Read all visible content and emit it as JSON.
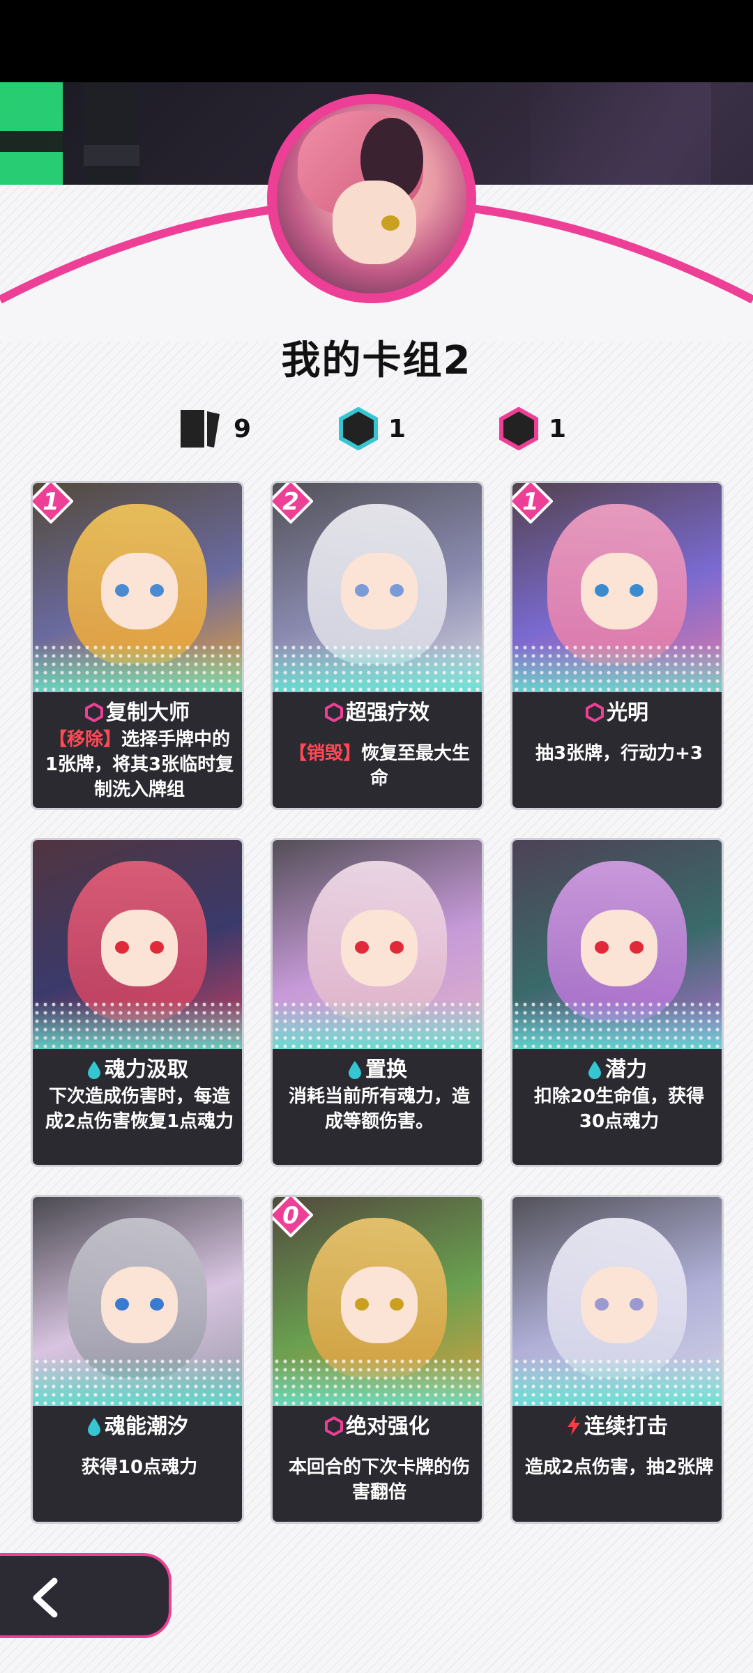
{
  "deck": {
    "title": "我的卡组2",
    "stats": [
      {
        "icon": "card-stack-icon",
        "value": "9"
      },
      {
        "icon": "cyan-hexagon-icon",
        "value": "1"
      },
      {
        "icon": "pink-hexagon-icon",
        "value": "1"
      }
    ]
  },
  "colors": {
    "accent_pink": "#ee3f96",
    "accent_cyan": "#35c6d2",
    "keyword_red": "#ff4a55",
    "card_bg": "#2b2a31"
  },
  "cards": [
    {
      "cost": "1",
      "icon": "hexagon-icon",
      "name": "复制大师",
      "keyword": "【移除】",
      "desc": "选择手牌中的1张牌，将其3张临时复制洗入牌组"
    },
    {
      "cost": "2",
      "icon": "hexagon-icon",
      "name": "超强疗效",
      "keyword": "【销毁】",
      "desc": "恢复至最大生命"
    },
    {
      "cost": "1",
      "icon": "hexagon-icon",
      "name": "光明",
      "keyword": "",
      "desc": "抽3张牌，行动力+3"
    },
    {
      "cost": "",
      "icon": "water-drop-icon",
      "name": "魂力汲取",
      "keyword": "",
      "desc": "下次造成伤害时，每造成2点伤害恢复1点魂力"
    },
    {
      "cost": "",
      "icon": "water-drop-icon",
      "name": "置换",
      "keyword": "",
      "desc": "消耗当前所有魂力，造成等额伤害。"
    },
    {
      "cost": "",
      "icon": "water-drop-icon",
      "name": "潜力",
      "keyword": "",
      "desc": "扣除20生命值，获得30点魂力"
    },
    {
      "cost": "",
      "icon": "water-drop-icon",
      "name": "魂能潮汐",
      "keyword": "",
      "desc": "获得10点魂力"
    },
    {
      "cost": "0",
      "icon": "hexagon-icon",
      "name": "绝对强化",
      "keyword": "",
      "desc": "本回合的下次卡牌的伤害翻倍"
    },
    {
      "cost": "",
      "icon": "lightning-icon",
      "name": "连续打击",
      "keyword": "",
      "desc": "造成2点伤害，抽2张牌"
    }
  ]
}
